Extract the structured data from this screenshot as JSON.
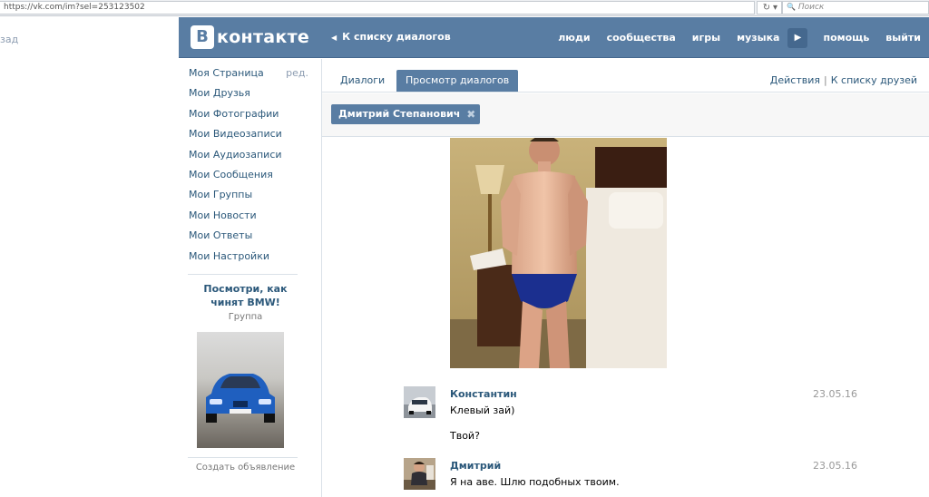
{
  "browser": {
    "url": "https://vk.com/im?sel=253123502",
    "refresh_glyph": "↻",
    "dropdown_glyph": "▾",
    "search_placeholder": "Поиск",
    "search_glyph": "🔍"
  },
  "left_fragment": {
    "text": "зад"
  },
  "header": {
    "logo_letter": "В",
    "logo_text": "контакте",
    "back_arrow": "◀",
    "back_label": "К списку диалогов",
    "nav": [
      "люди",
      "сообщества",
      "игры",
      "музыка"
    ],
    "play_glyph": "▶",
    "nav_right": [
      "помощь",
      "выйти"
    ]
  },
  "sidebar": {
    "items": [
      "Моя Страница",
      "Мои Друзья",
      "Мои Фотографии",
      "Мои Видеозаписи",
      "Мои Аудиозаписи",
      "Мои Сообщения",
      "Мои Группы",
      "Мои Новости",
      "Мои Ответы",
      "Мои Настройки"
    ],
    "edit_label": "ред.",
    "ad": {
      "title_line1": "Посмотри, как",
      "title_line2": "чинят BMW!",
      "subtitle": "Группа",
      "create_label": "Создать объявление"
    }
  },
  "tabs": {
    "dialogs": "Диалоги",
    "view": "Просмотр диалогов",
    "actions": "Действия",
    "separator": "|",
    "friends": "К списку друзей"
  },
  "filter": {
    "chip_label": "Дмитрий Степанович",
    "chip_close": "✖"
  },
  "messages": [
    {
      "author": "Константин",
      "date": "23.05.16",
      "lines": [
        "Клевый зай)",
        "Твой?"
      ]
    },
    {
      "author": "Дмитрий",
      "date": "23.05.16",
      "lines": [
        "Я на аве. Шлю подобных твоим."
      ]
    }
  ],
  "colors": {
    "header_blue": "#597da3",
    "link_blue": "#2b587a",
    "divider": "#dae1e8"
  }
}
